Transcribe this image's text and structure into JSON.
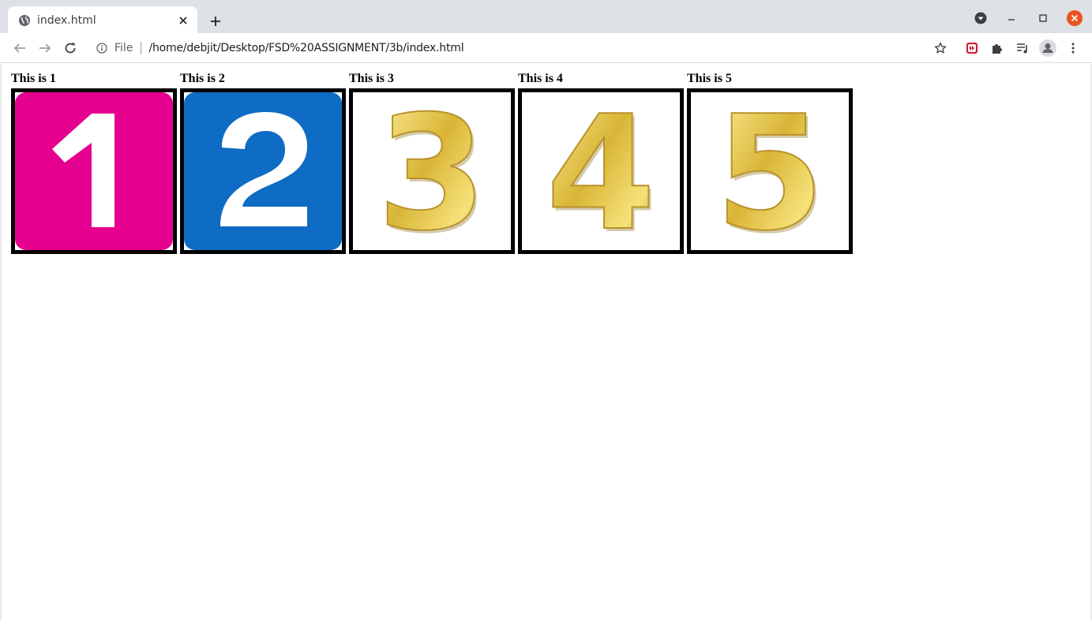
{
  "browser": {
    "tab_title": "index.html",
    "scheme_label": "File",
    "url": "/home/debjit/Desktop/FSD%20ASSIGNMENT/3b/index.html"
  },
  "items": [
    {
      "label": "This is 1",
      "digit": "1",
      "style": "flat-tile",
      "bg": "#e6008f"
    },
    {
      "label": "This is 2",
      "digit": "2",
      "style": "flat-tile",
      "bg": "#0f6cc4"
    },
    {
      "label": "This is 3",
      "digit": "3",
      "style": "gold-3d"
    },
    {
      "label": "This is 4",
      "digit": "4",
      "style": "gold-3d"
    },
    {
      "label": "This is 5",
      "digit": "5",
      "style": "gold-3d"
    }
  ],
  "icons": {
    "tab": "globe-icon",
    "close": "close-icon",
    "newtab": "plus-icon",
    "back": "back-arrow-icon",
    "forward": "forward-arrow-icon",
    "reload": "reload-icon",
    "info": "info-icon",
    "bookmark": "star-icon",
    "extensions": [
      "media-extension-icon",
      "puzzle-icon",
      "media-control-icon",
      "profile-icon",
      "kebab-menu-icon"
    ]
  },
  "colors": {
    "titlebar": "#dee1e6",
    "close_button": "#e95420",
    "gold": "#d4af37"
  }
}
